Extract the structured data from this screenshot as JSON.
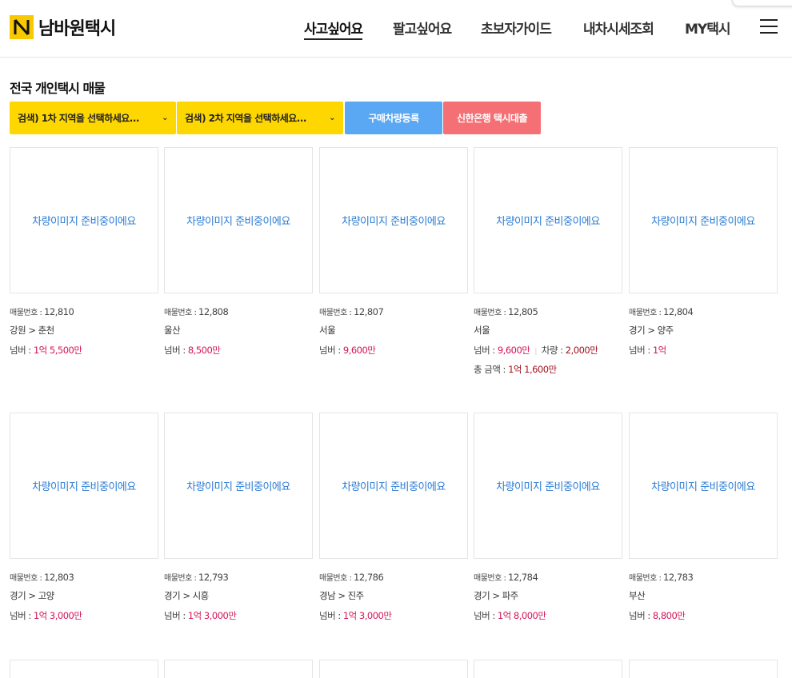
{
  "header": {
    "logo_text": "남바원택시",
    "nav": [
      "사고싶어요",
      "팔고싶어요",
      "초보자가이드",
      "내차시세조회",
      "MY택시"
    ]
  },
  "main": {
    "title": "전국 개인택시 매물",
    "select1": "검색) 1차 지역을 선택하세요...",
    "select2": "검색) 2차 지역을 선택하세요...",
    "btn_register": "구매차량등록",
    "btn_loan": "신한은행 택시대출",
    "image_placeholder": "차량이미지 준비중이에요",
    "no_label": "매물번호 : ",
    "price_label": "넘버 : ",
    "car_label": "차량 : ",
    "total_label": "총 금액 : "
  },
  "listings": [
    {
      "no": "12,810",
      "region": "강원 > 춘천",
      "price": "1억 5,500만"
    },
    {
      "no": "12,808",
      "region": "울산",
      "price": "8,500만"
    },
    {
      "no": "12,807",
      "region": "서울",
      "price": "9,600만"
    },
    {
      "no": "12,805",
      "region": "서울",
      "price": "9,600만",
      "car": "2,000만",
      "total": "1억 1,600만"
    },
    {
      "no": "12,804",
      "region": "경기 > 양주",
      "price": "1억"
    },
    {
      "no": "12,803",
      "region": "경기 > 고양",
      "price": "1억 3,000만"
    },
    {
      "no": "12,793",
      "region": "경기 > 시흥",
      "price": "1억 3,000만"
    },
    {
      "no": "12,786",
      "region": "경남 > 진주",
      "price": "1억 3,000만"
    },
    {
      "no": "12,784",
      "region": "경기 > 파주",
      "price": "1억 8,000만"
    },
    {
      "no": "12,783",
      "region": "부산",
      "price": "8,800만"
    }
  ],
  "colors": {
    "brand_yellow": "#ffd700",
    "btn_blue": "#5aa8f4",
    "btn_red": "#f47075",
    "price": "#d4145a",
    "link_blue": "#2a7bd3"
  },
  "icons": {
    "menu": "hamburger-icon",
    "select": "chevron-down-icon",
    "logo": "n-logo-icon"
  }
}
